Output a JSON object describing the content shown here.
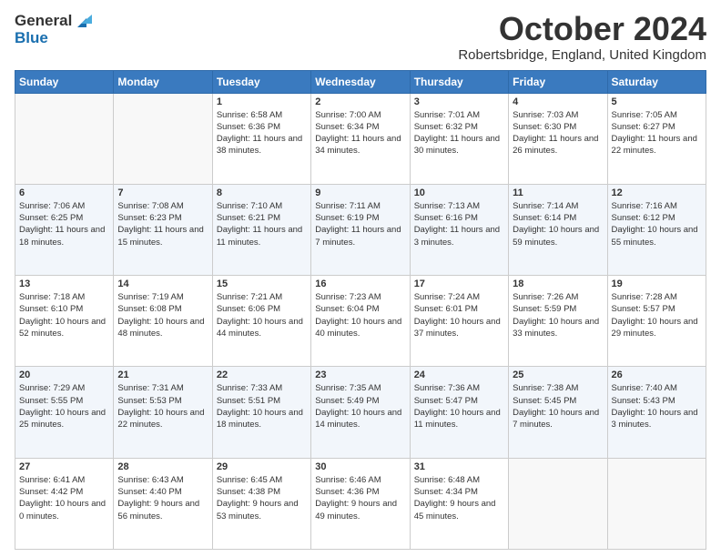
{
  "header": {
    "logo_line1": "General",
    "logo_line2": "Blue",
    "month": "October 2024",
    "location": "Robertsbridge, England, United Kingdom"
  },
  "weekdays": [
    "Sunday",
    "Monday",
    "Tuesday",
    "Wednesday",
    "Thursday",
    "Friday",
    "Saturday"
  ],
  "weeks": [
    [
      {
        "day": "",
        "sunrise": "",
        "sunset": "",
        "daylight": ""
      },
      {
        "day": "",
        "sunrise": "",
        "sunset": "",
        "daylight": ""
      },
      {
        "day": "1",
        "sunrise": "Sunrise: 6:58 AM",
        "sunset": "Sunset: 6:36 PM",
        "daylight": "Daylight: 11 hours and 38 minutes."
      },
      {
        "day": "2",
        "sunrise": "Sunrise: 7:00 AM",
        "sunset": "Sunset: 6:34 PM",
        "daylight": "Daylight: 11 hours and 34 minutes."
      },
      {
        "day": "3",
        "sunrise": "Sunrise: 7:01 AM",
        "sunset": "Sunset: 6:32 PM",
        "daylight": "Daylight: 11 hours and 30 minutes."
      },
      {
        "day": "4",
        "sunrise": "Sunrise: 7:03 AM",
        "sunset": "Sunset: 6:30 PM",
        "daylight": "Daylight: 11 hours and 26 minutes."
      },
      {
        "day": "5",
        "sunrise": "Sunrise: 7:05 AM",
        "sunset": "Sunset: 6:27 PM",
        "daylight": "Daylight: 11 hours and 22 minutes."
      }
    ],
    [
      {
        "day": "6",
        "sunrise": "Sunrise: 7:06 AM",
        "sunset": "Sunset: 6:25 PM",
        "daylight": "Daylight: 11 hours and 18 minutes."
      },
      {
        "day": "7",
        "sunrise": "Sunrise: 7:08 AM",
        "sunset": "Sunset: 6:23 PM",
        "daylight": "Daylight: 11 hours and 15 minutes."
      },
      {
        "day": "8",
        "sunrise": "Sunrise: 7:10 AM",
        "sunset": "Sunset: 6:21 PM",
        "daylight": "Daylight: 11 hours and 11 minutes."
      },
      {
        "day": "9",
        "sunrise": "Sunrise: 7:11 AM",
        "sunset": "Sunset: 6:19 PM",
        "daylight": "Daylight: 11 hours and 7 minutes."
      },
      {
        "day": "10",
        "sunrise": "Sunrise: 7:13 AM",
        "sunset": "Sunset: 6:16 PM",
        "daylight": "Daylight: 11 hours and 3 minutes."
      },
      {
        "day": "11",
        "sunrise": "Sunrise: 7:14 AM",
        "sunset": "Sunset: 6:14 PM",
        "daylight": "Daylight: 10 hours and 59 minutes."
      },
      {
        "day": "12",
        "sunrise": "Sunrise: 7:16 AM",
        "sunset": "Sunset: 6:12 PM",
        "daylight": "Daylight: 10 hours and 55 minutes."
      }
    ],
    [
      {
        "day": "13",
        "sunrise": "Sunrise: 7:18 AM",
        "sunset": "Sunset: 6:10 PM",
        "daylight": "Daylight: 10 hours and 52 minutes."
      },
      {
        "day": "14",
        "sunrise": "Sunrise: 7:19 AM",
        "sunset": "Sunset: 6:08 PM",
        "daylight": "Daylight: 10 hours and 48 minutes."
      },
      {
        "day": "15",
        "sunrise": "Sunrise: 7:21 AM",
        "sunset": "Sunset: 6:06 PM",
        "daylight": "Daylight: 10 hours and 44 minutes."
      },
      {
        "day": "16",
        "sunrise": "Sunrise: 7:23 AM",
        "sunset": "Sunset: 6:04 PM",
        "daylight": "Daylight: 10 hours and 40 minutes."
      },
      {
        "day": "17",
        "sunrise": "Sunrise: 7:24 AM",
        "sunset": "Sunset: 6:01 PM",
        "daylight": "Daylight: 10 hours and 37 minutes."
      },
      {
        "day": "18",
        "sunrise": "Sunrise: 7:26 AM",
        "sunset": "Sunset: 5:59 PM",
        "daylight": "Daylight: 10 hours and 33 minutes."
      },
      {
        "day": "19",
        "sunrise": "Sunrise: 7:28 AM",
        "sunset": "Sunset: 5:57 PM",
        "daylight": "Daylight: 10 hours and 29 minutes."
      }
    ],
    [
      {
        "day": "20",
        "sunrise": "Sunrise: 7:29 AM",
        "sunset": "Sunset: 5:55 PM",
        "daylight": "Daylight: 10 hours and 25 minutes."
      },
      {
        "day": "21",
        "sunrise": "Sunrise: 7:31 AM",
        "sunset": "Sunset: 5:53 PM",
        "daylight": "Daylight: 10 hours and 22 minutes."
      },
      {
        "day": "22",
        "sunrise": "Sunrise: 7:33 AM",
        "sunset": "Sunset: 5:51 PM",
        "daylight": "Daylight: 10 hours and 18 minutes."
      },
      {
        "day": "23",
        "sunrise": "Sunrise: 7:35 AM",
        "sunset": "Sunset: 5:49 PM",
        "daylight": "Daylight: 10 hours and 14 minutes."
      },
      {
        "day": "24",
        "sunrise": "Sunrise: 7:36 AM",
        "sunset": "Sunset: 5:47 PM",
        "daylight": "Daylight: 10 hours and 11 minutes."
      },
      {
        "day": "25",
        "sunrise": "Sunrise: 7:38 AM",
        "sunset": "Sunset: 5:45 PM",
        "daylight": "Daylight: 10 hours and 7 minutes."
      },
      {
        "day": "26",
        "sunrise": "Sunrise: 7:40 AM",
        "sunset": "Sunset: 5:43 PM",
        "daylight": "Daylight: 10 hours and 3 minutes."
      }
    ],
    [
      {
        "day": "27",
        "sunrise": "Sunrise: 6:41 AM",
        "sunset": "Sunset: 4:42 PM",
        "daylight": "Daylight: 10 hours and 0 minutes."
      },
      {
        "day": "28",
        "sunrise": "Sunrise: 6:43 AM",
        "sunset": "Sunset: 4:40 PM",
        "daylight": "Daylight: 9 hours and 56 minutes."
      },
      {
        "day": "29",
        "sunrise": "Sunrise: 6:45 AM",
        "sunset": "Sunset: 4:38 PM",
        "daylight": "Daylight: 9 hours and 53 minutes."
      },
      {
        "day": "30",
        "sunrise": "Sunrise: 6:46 AM",
        "sunset": "Sunset: 4:36 PM",
        "daylight": "Daylight: 9 hours and 49 minutes."
      },
      {
        "day": "31",
        "sunrise": "Sunrise: 6:48 AM",
        "sunset": "Sunset: 4:34 PM",
        "daylight": "Daylight: 9 hours and 45 minutes."
      },
      {
        "day": "",
        "sunrise": "",
        "sunset": "",
        "daylight": ""
      },
      {
        "day": "",
        "sunrise": "",
        "sunset": "",
        "daylight": ""
      }
    ]
  ]
}
